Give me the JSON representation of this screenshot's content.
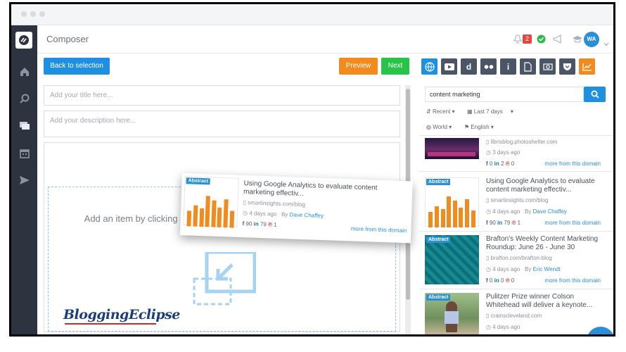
{
  "app": {
    "title": "Composer"
  },
  "topbar": {
    "notification_count": "2",
    "avatar_initials": "WA"
  },
  "toolbar": {
    "back_label": "Back to selection",
    "preview_label": "Preview",
    "next_label": "Next"
  },
  "editor": {
    "title_placeholder": "Add your title here...",
    "description_placeholder": "Add your description here...",
    "dropzone_text": "Add an item by clicking on it in the right sidebar in here."
  },
  "search": {
    "query": "content marketing"
  },
  "filters": {
    "sort": "Recent",
    "date_range": "Last 7 days",
    "region": "World",
    "language": "English"
  },
  "sources": [
    "web",
    "youtube",
    "dailymotion",
    "flickr",
    "info",
    "document",
    "instagram",
    "pocket",
    "trending"
  ],
  "results": [
    {
      "domain": "librisblog.photoshelter.com",
      "age": "3 days ago",
      "fb": "0",
      "li": "2",
      "pin": "0",
      "more": "more from this domain"
    },
    {
      "abstract": "Abstract",
      "title": "Using Google Analytics to evaluate content marketing effectiv...",
      "domain": "smartinsights.com/blog",
      "age": "4 days ago",
      "by": "By",
      "author": "Dave Chaffey",
      "fb": "90",
      "li": "79",
      "pin": "1",
      "more": "more from this domain"
    },
    {
      "abstract": "Abstract",
      "title": "Brafton's Weekly Content Marketing Roundup: June 26 - June 30",
      "domain": "brafton.com/brafton-blog",
      "age": "4 days ago",
      "by": "By",
      "author": "Eric Wendt",
      "fb": "0",
      "li": "0",
      "pin": "0",
      "more": "more from this domain"
    },
    {
      "abstract": "Abstract",
      "title": "Pulitzer Prize winner Colson Whitehead will deliver a keynote...",
      "domain": "crainscleveland.com",
      "age": "4 days ago"
    }
  ],
  "dragged": {
    "abstract": "Abstract",
    "title": "Using Google Analytics to evaluate content marketing effectiv...",
    "domain": "smartinsights.com/blog",
    "age": "4 days ago",
    "by": "By",
    "author": "Dave Chaffey",
    "fb": "90",
    "li": "79",
    "pin": "1",
    "more": "more from this domain"
  },
  "watermark": "BloggingEclipse",
  "colors": {
    "accent": "#1f8fe0",
    "orange": "#f28b1e",
    "green": "#29c34a",
    "sidebar": "#2d3440"
  }
}
